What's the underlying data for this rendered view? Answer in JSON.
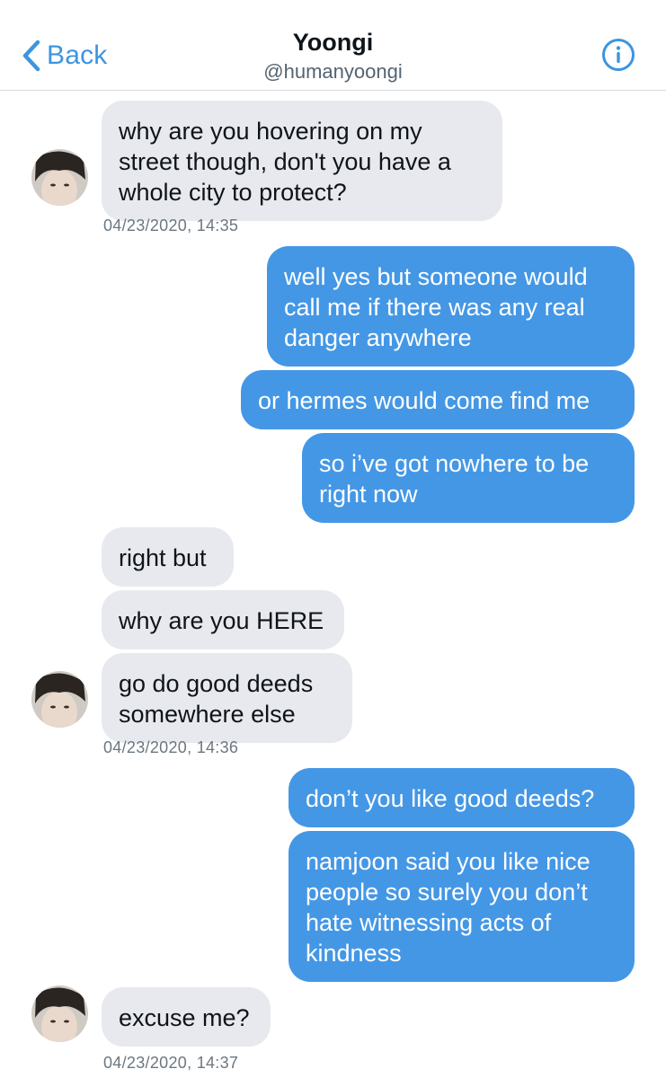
{
  "header": {
    "back_label": "Back",
    "name": "Yoongi",
    "handle": "@humanyoongi",
    "accent": "#3d95e0"
  },
  "icons": {
    "back": "chevron-left-icon",
    "info": "info-icon",
    "avatar": "avatar"
  },
  "colors": {
    "incoming_bubble": "#e7e9ee",
    "outgoing_bubble": "#4497e5"
  },
  "messages": [
    {
      "direction": "incoming",
      "text": "why are you hovering on my\nstreet though, don't you have a\nwhole city to protect?"
    },
    {
      "direction": "outgoing",
      "text": "well yes but someone would\ncall me if there was any real\ndanger anywhere"
    },
    {
      "direction": "outgoing",
      "text": "or hermes would come find me"
    },
    {
      "direction": "outgoing",
      "text": "so i’ve got nowhere to be\nright now"
    },
    {
      "direction": "incoming",
      "text": "right but"
    },
    {
      "direction": "incoming",
      "text": "why are you HERE"
    },
    {
      "direction": "incoming",
      "text": "go do good deeds\nsomewhere else"
    },
    {
      "direction": "outgoing",
      "text": "don’t you like good deeds?"
    },
    {
      "direction": "outgoing",
      "text": "namjoon said you like nice\npeople so surely you don’t\nhate witnessing acts of\nkindness"
    },
    {
      "direction": "incoming",
      "text": "excuse me?"
    }
  ],
  "timestamps": [
    "04/23/2020, 14:35",
    "04/23/2020, 14:36",
    "04/23/2020, 14:37"
  ]
}
